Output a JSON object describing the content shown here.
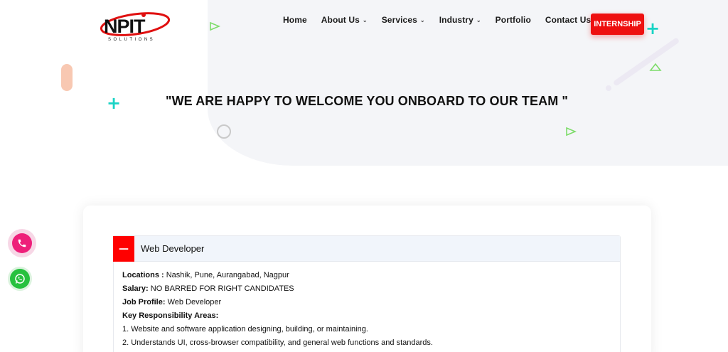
{
  "logo": {
    "text": "NPIT",
    "subtext": "SOLUTIONS",
    "icon": "npit-logo"
  },
  "nav": {
    "items": [
      {
        "label": "Home",
        "has_dropdown": false
      },
      {
        "label": "About Us",
        "has_dropdown": true
      },
      {
        "label": "Services",
        "has_dropdown": true
      },
      {
        "label": "Industry",
        "has_dropdown": true
      },
      {
        "label": "Portfolio",
        "has_dropdown": false
      },
      {
        "label": "Contact Us",
        "has_dropdown": false
      }
    ],
    "cta_label": "INTERNSHIP",
    "chevron_icon": "chevron-down-icon"
  },
  "hero": {
    "headline": "\"WE ARE HAPPY TO WELCOME YOU ONBOARD TO OUR TEAM \""
  },
  "job": {
    "toggle_symbol": "—",
    "title": "Web Developer",
    "details": [
      {
        "label": "Locations :",
        "value": " Nashik, Pune, Aurangabad, Nagpur"
      },
      {
        "label": "Salary:",
        "value": " NO BARRED FOR RIGHT CANDIDATES"
      },
      {
        "label": "Job Profile:",
        "value": " Web Developer"
      },
      {
        "label": "Key Responsibility Areas:",
        "value": ""
      }
    ],
    "responsibilities": [
      "1. Website and software application designing, building, or maintaining.",
      "2. Understands UI, cross-browser compatibility, and general web functions and standards."
    ]
  },
  "floating": {
    "phone_icon": "phone-icon",
    "whatsapp_icon": "whatsapp-icon"
  },
  "colors": {
    "brand_red": "#ee1010",
    "accent_teal": "#19d3c5",
    "accent_green": "#7ddc6a",
    "phone_pink": "#ee1f7a",
    "whatsapp_green": "#27c13f"
  }
}
